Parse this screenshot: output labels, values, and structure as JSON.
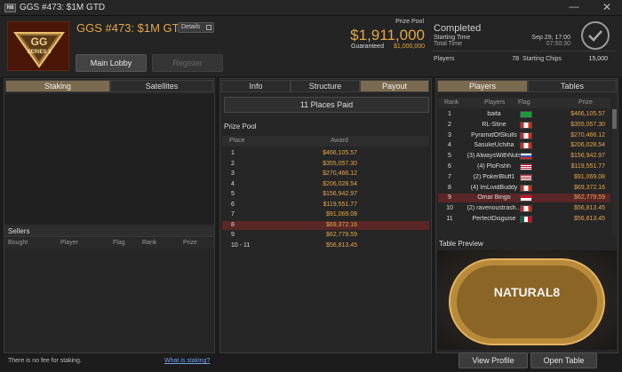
{
  "window": {
    "app_icon": "N8",
    "title": "GGS #473: $1M GTD",
    "minimize": "—",
    "close": "✕"
  },
  "header": {
    "tournament_name": "GGS #473: $1M GTD",
    "details_label": "Details",
    "prize_pool_label": "Prize Pool",
    "prize_pool": "$1,911,000",
    "guaranteed_label": "Guaranteed",
    "guaranteed": "$1,000,000",
    "main_lobby_label": "Main Lobby",
    "register_label": "Register",
    "logo_text": "SERIES 3"
  },
  "status": {
    "state": "Completed",
    "starting_time_label": "Starting Time",
    "starting_time": "Sep 29, 17:00",
    "total_time_label": "Total Time",
    "total_time": "07:50:30",
    "players_label": "Players",
    "players": "78",
    "starting_chips_label": "Starting Chips",
    "starting_chips": "15,000"
  },
  "left": {
    "tabs": [
      {
        "label": "Staking",
        "active": true
      },
      {
        "label": "Satellites",
        "active": false
      }
    ],
    "sellers_title": "Sellers",
    "sellers_columns": [
      "Bought",
      "Player",
      "Flag",
      "Rank",
      "Prize"
    ],
    "footer_note": "There is no fee for staking.",
    "footer_link": "What is staking?"
  },
  "middle": {
    "tabs": [
      {
        "label": "Info",
        "active": false
      },
      {
        "label": "Structure",
        "active": false
      },
      {
        "label": "Payout",
        "active": true
      }
    ],
    "places_paid": "11 Places Paid",
    "prize_pool_title": "Prize Pool",
    "columns": [
      "Place",
      "Award"
    ],
    "payouts": [
      {
        "place": "1",
        "award": "$466,105.57"
      },
      {
        "place": "2",
        "award": "$355,057.30"
      },
      {
        "place": "3",
        "award": "$270,466.12"
      },
      {
        "place": "4",
        "award": "$206,028.54"
      },
      {
        "place": "5",
        "award": "$156,942.97"
      },
      {
        "place": "6",
        "award": "$119,551.77"
      },
      {
        "place": "7",
        "award": "$91,069.08"
      },
      {
        "place": "8",
        "award": "$69,372.16"
      },
      {
        "place": "9",
        "award": "$62,779.59"
      },
      {
        "place": "10 - 11",
        "award": "$56,813.45"
      }
    ]
  },
  "right": {
    "tabs": [
      {
        "label": "Players",
        "active": true
      },
      {
        "label": "Tables",
        "active": false
      }
    ],
    "columns": [
      "Rank",
      "Players",
      "Flag",
      "Prize"
    ],
    "players": [
      {
        "rank": "1",
        "name": "baita",
        "flag": "br",
        "prize": "$466,105.57"
      },
      {
        "rank": "2",
        "name": "RL-Stine",
        "flag": "ca",
        "prize": "$355,057.30"
      },
      {
        "rank": "3",
        "name": "PyramidOfSkulls",
        "flag": "ca",
        "prize": "$270,466.12"
      },
      {
        "rank": "4",
        "name": "SasukeUchiha",
        "flag": "ca",
        "prize": "$206,028.54"
      },
      {
        "rank": "5",
        "name": "(3) AlwaysWithNuts",
        "flag": "ru",
        "prize": "$156,942.97"
      },
      {
        "rank": "6",
        "name": "(4) PloFishh",
        "flag": "my",
        "prize": "$119,551.77"
      },
      {
        "rank": "7",
        "name": "(2) PokerBluff1",
        "flag": "us",
        "prize": "$91,069.08"
      },
      {
        "rank": "8",
        "name": "(4) ImLividBuddy",
        "flag": "ca",
        "prize": "$69,372.16"
      },
      {
        "rank": "9",
        "name": "Omar Bingo",
        "flag": "id",
        "prize": "$62,779.59"
      },
      {
        "rank": "10",
        "name": "(2) ravenoustrash...",
        "flag": "ca",
        "prize": "$56,813.45"
      },
      {
        "rank": "11",
        "name": "PerfectDisguise",
        "flag": "mx",
        "prize": "$56,813.45"
      }
    ],
    "table_preview_label": "Table Preview",
    "table_brand": "NATURAL8",
    "view_profile_label": "View Profile",
    "open_table_label": "Open Table"
  },
  "colors": {
    "accent": "#e3a64a",
    "tab_active": "#7a6a4f",
    "highlight_row": "#5a2626",
    "link": "#6f9ee8"
  }
}
